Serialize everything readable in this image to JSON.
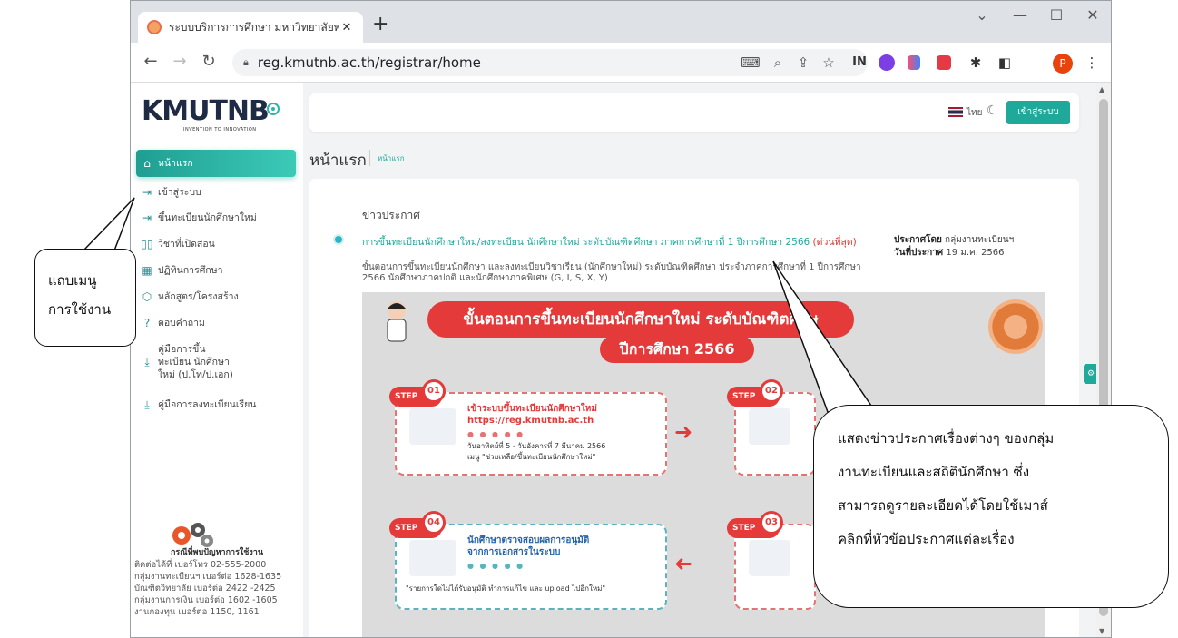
{
  "browser": {
    "tab_title": "ระบบบริการการศึกษา มหาวิทยาลัยพระ",
    "tab_close": "✕",
    "new_tab": "+",
    "url": "reg.kmutnb.ac.th/registrar/home",
    "profile_initial": "P",
    "extension_label": "IN"
  },
  "sidebar": {
    "logo_text": "KMUTNB",
    "logo_tagline": "INVENTION TO INNOVATION",
    "items": [
      {
        "label": "หน้าแรก",
        "icon": "home-icon"
      },
      {
        "label": "เข้าสู่ระบบ",
        "icon": "login-icon"
      },
      {
        "label": "ขึ้นทะเบียนนักศึกษาใหม่",
        "icon": "login-icon"
      },
      {
        "label": "วิชาที่เปิดสอน",
        "icon": "book-icon"
      },
      {
        "label": "ปฏิทินการศึกษา",
        "icon": "calendar-icon"
      },
      {
        "label": "หลักสูตร/โครงสร้าง",
        "icon": "cube-icon"
      },
      {
        "label": "ตอบคำถาม",
        "icon": "question-icon"
      },
      {
        "label": "คู่มือการขึ้นทะเบียน นักศึกษาใหม่ (ป.โท/ป.เอก)",
        "icon": "download-icon"
      },
      {
        "label": "คู่มือการลงทะเบียนเรียน",
        "icon": "download-icon"
      }
    ],
    "footer": {
      "title": "กรณีที่พบปัญหาการใช้งาน",
      "lines": [
        "ติดต่อได้ที่ เบอร์โทร 02-555-2000",
        "กลุ่มงานทะเบียนฯ เบอร์ต่อ 1628-1635",
        "บัณฑิตวิทยาลัย เบอร์ต่อ 2422 -2425",
        "กลุ่มงานการเงิน เบอร์ต่อ 1602 -1605",
        "งานกองทุน เบอร์ต่อ 1150, 1161"
      ]
    }
  },
  "topbar": {
    "lang": "ไทย",
    "login_button": "เข้าสู่ระบบ"
  },
  "page": {
    "title": "หน้าแรก",
    "breadcrumb": "หน้าแรก"
  },
  "news": {
    "heading": "ข่าวประกาศ",
    "item_title": "การขึ้นทะเบียนนักศึกษาใหม่/ลงทะเบียน นักศึกษาใหม่ ระดับบัณฑิตศึกษา ภาคการศึกษาที่ 1 ปีการศึกษา 2566",
    "item_urgent": "(ด่วนที่สุด)",
    "by_label": "ประกาศโดย",
    "by_value": "กลุ่มงานทะเบียนฯ",
    "date_label": "วันที่ประกาศ",
    "date_value": "19 ม.ค. 2566",
    "description": "ขั้นตอนการขึ้นทะเบียนนักศึกษา และลงทะเบียนวิชาเรียน (นักศึกษาใหม่) ระดับบัณฑิตศึกษา ประจำภาคการศึกษาที่ 1 ปีการศึกษา 2566 นักศึกษาภาคปกติ และนักศึกษาภาคพิเศษ (G, I, S, X, Y)"
  },
  "poster": {
    "banner": "ขั้นตอนการขึ้นทะเบียนนักศึกษาใหม่ ระดับบัณฑิตศึกษ",
    "year": "ปีการศึกษา 2566",
    "step_label": "STEP",
    "step1": {
      "num": "01",
      "head1": "เข้าระบบขึ้นทะเบียนนักศึกษาใหม่",
      "head2": "https://reg.kmutnb.ac.th",
      "date": "วันอาทิตย์ที่ 5 - วันอังคารที่ 7 มีนาคม 2566",
      "menu": "เมนู \"ช่วยเหลือ/ขึ้นทะเบียนนักศึกษาใหม่\""
    },
    "step2": {
      "num": "02"
    },
    "step3": {
      "num": "03"
    },
    "step4": {
      "num": "04",
      "head1": "นักศึกษาตรวจสอบผลการอนุมัติ",
      "head2": "จากการเอกสารในระบบ",
      "note_a": "\"รายการใดไม่ได้รับอนุมัติ",
      "note_b": " ทำการแก้ไข และ upload ไปอีกใหม่\""
    }
  },
  "annotations": {
    "left_line1": "แถบเมนู",
    "left_line2": "การใช้งาน",
    "right_lines": [
      "แสดงข่าวประกาศเรื่องต่างๆ ของกลุ่ม",
      "งานทะเบียนและสถิตินักศึกษา ซึ่ง",
      "สามารถดูรายละเอียดได้โดยใช้เมาส์",
      "คลิกที่หัวข้อประกาศแต่ละเรื่อง"
    ]
  }
}
